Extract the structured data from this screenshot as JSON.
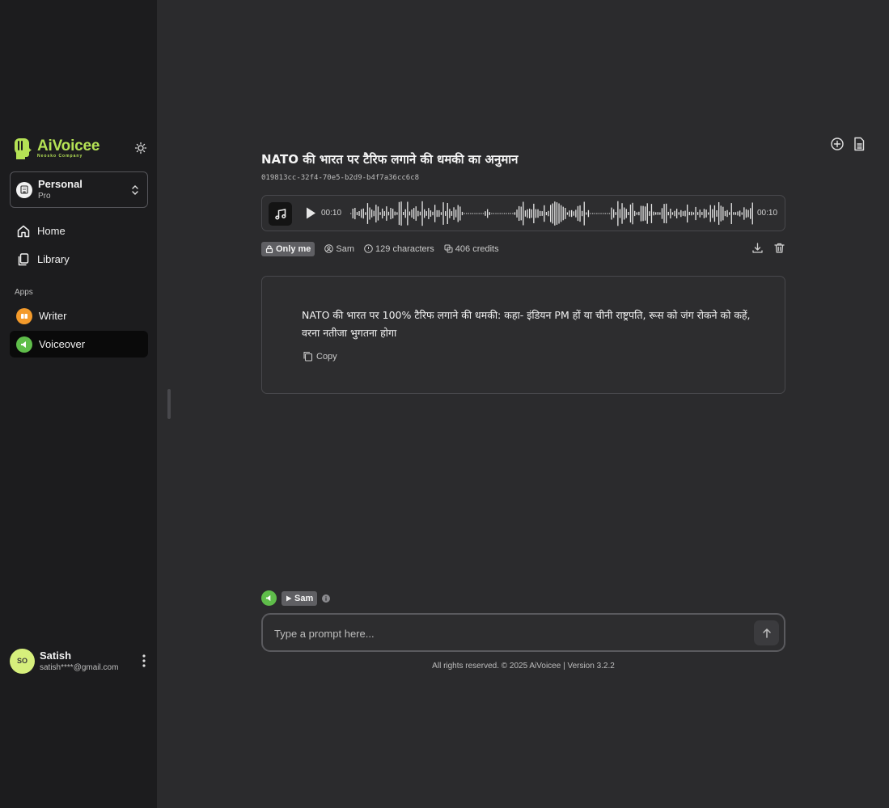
{
  "sidebar": {
    "brand": {
      "name": "AiVoicee",
      "tagline": "Neosko Company",
      "color": "#b5e255"
    },
    "workspace": {
      "name": "Personal",
      "plan": "Pro"
    },
    "nav": [
      {
        "label": "Home",
        "icon": "home-icon"
      },
      {
        "label": "Library",
        "icon": "library-icon"
      }
    ],
    "apps_label": "Apps",
    "apps": [
      {
        "label": "Writer",
        "icon": "writer-app-icon",
        "color": "#f39a2b"
      },
      {
        "label": "Voiceover",
        "icon": "voiceover-app-icon",
        "color": "#5fbd4a",
        "active": true
      }
    ],
    "user": {
      "initials": "SO",
      "name": "Satish",
      "email": "satish****@gmail.com"
    }
  },
  "main": {
    "title": "NATO की भारत पर टैरिफ लगाने की धमकी का अनुमान",
    "id": "019813cc-32f4-70e5-b2d9-b4f7a36cc6c8",
    "player": {
      "current_time": "00:10",
      "duration": "00:10"
    },
    "meta": {
      "visibility": "Only me",
      "voice": "Sam",
      "characters": "129 characters",
      "credits": "406 credits"
    },
    "text": "NATO की भारत पर 100% टैरिफ लगाने की धमकी: कहा- इंडियन PM हों या चीनी राष्ट्रपति, रूस को जंग रोकने को कहें, वरना नतीजा भुगतना होगा",
    "copy_label": "Copy"
  },
  "composer": {
    "voice_name": "Sam",
    "placeholder": "Type a prompt here...",
    "footer": "All rights reserved. © 2025 AiVoicee | Version 3.2.2"
  }
}
